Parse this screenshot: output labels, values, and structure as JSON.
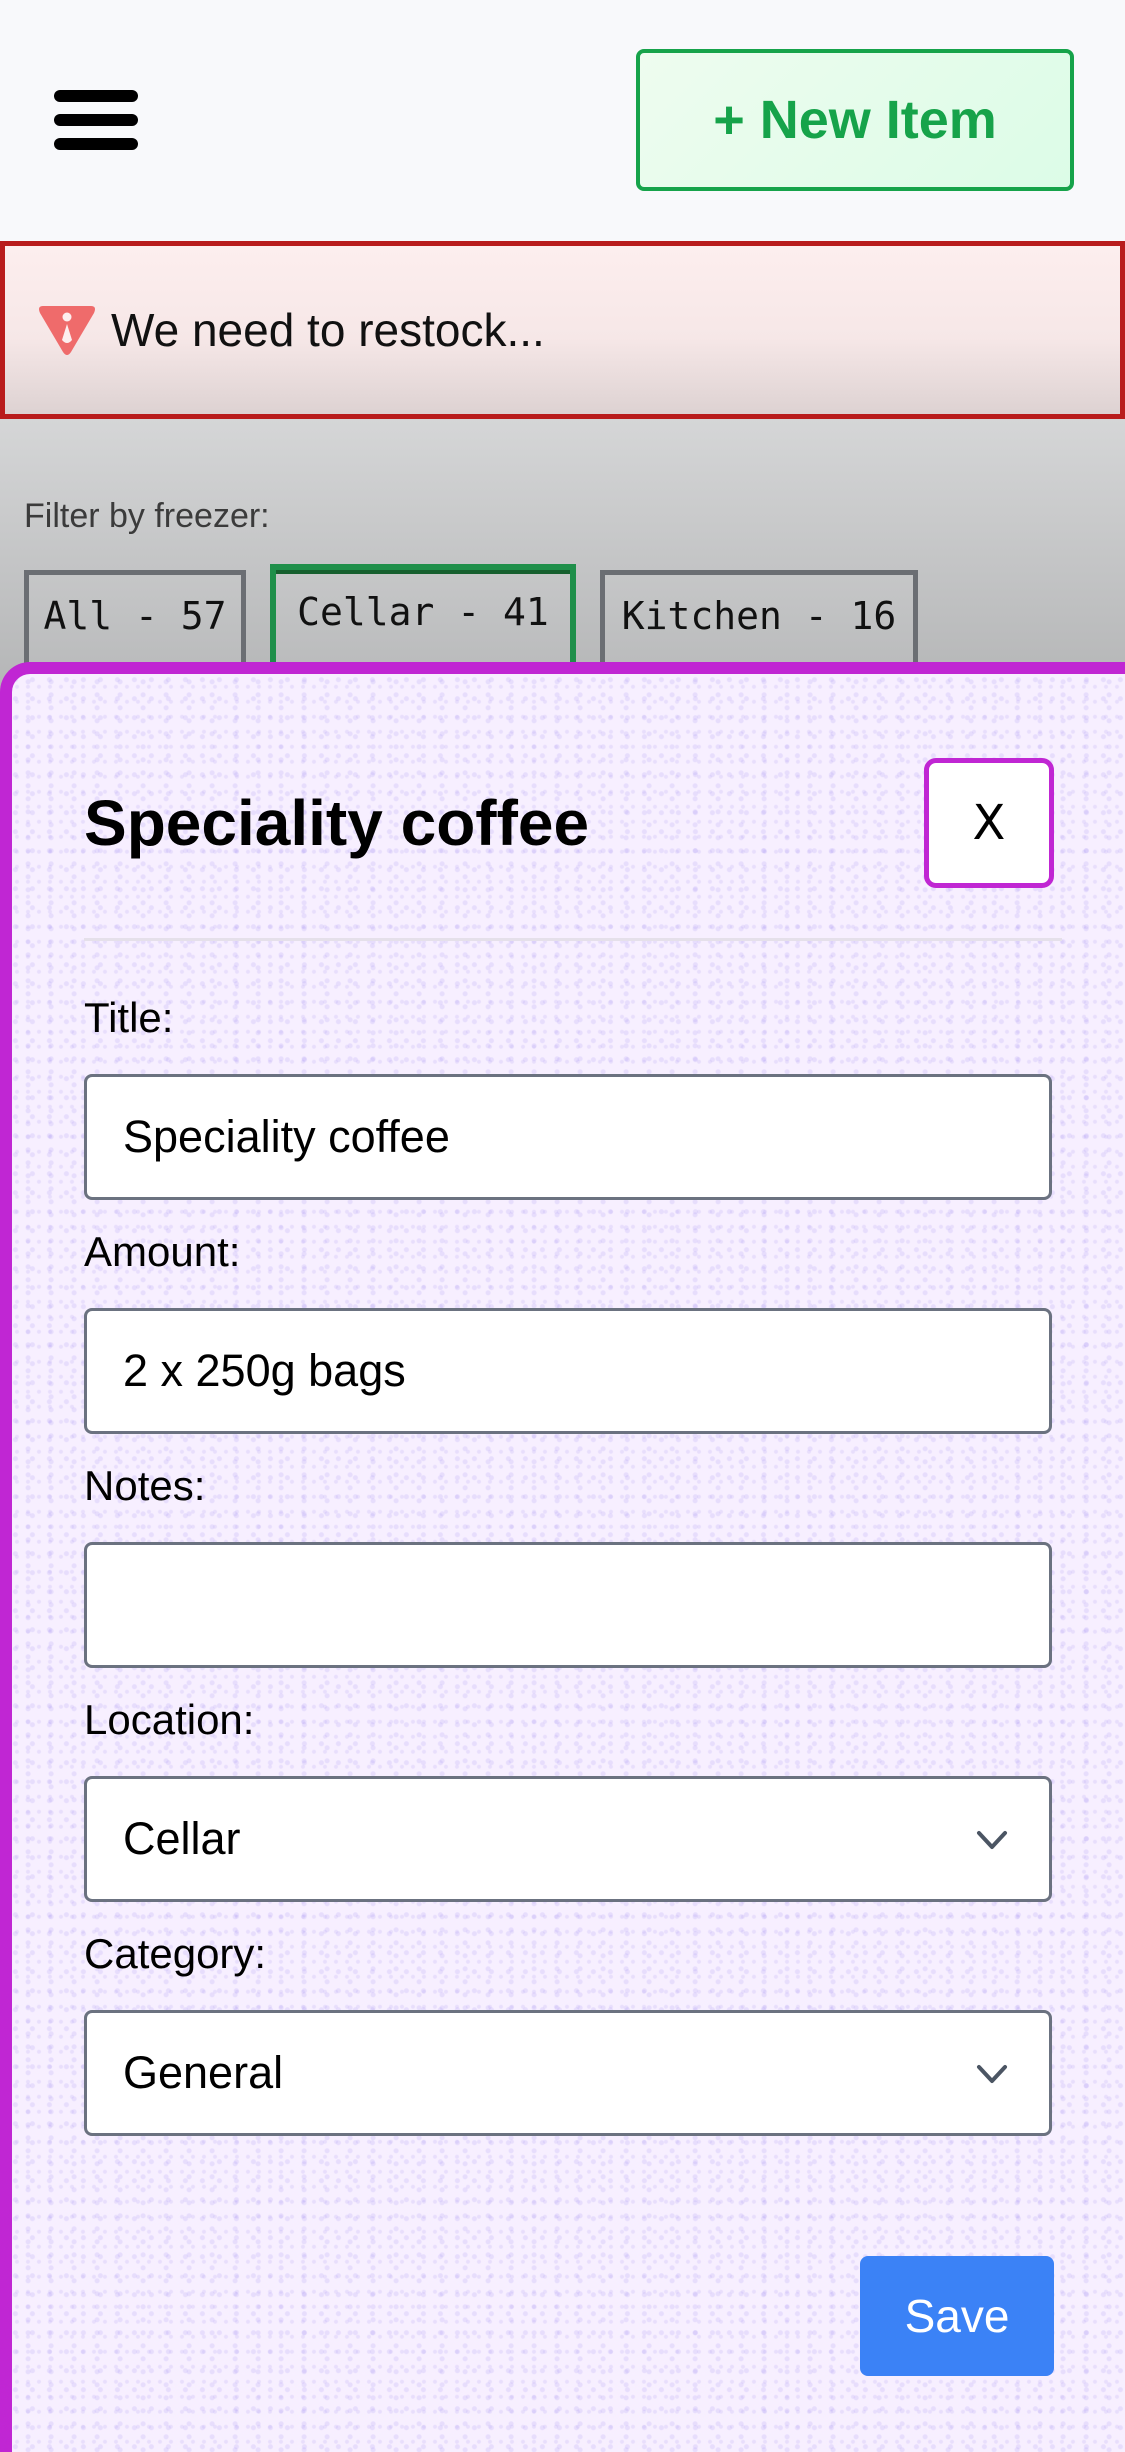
{
  "header": {
    "menu_icon": "hamburger-menu-icon",
    "new_item_label": "+ New Item"
  },
  "alert": {
    "icon": "warning-triangle-icon",
    "text": "We need to restock...",
    "border_color": "#b91c1c"
  },
  "filter": {
    "label": "Filter by freezer:",
    "tabs": [
      {
        "label": "All - 57",
        "selected": false
      },
      {
        "label": "Cellar - 41",
        "selected": true
      },
      {
        "label": "Kitchen - 16",
        "selected": false
      }
    ]
  },
  "modal": {
    "title": "Speciality coffee",
    "close_label": "X",
    "accent_color": "#c026d3",
    "fields": {
      "title": {
        "label": "Title:",
        "value": "Speciality coffee"
      },
      "amount": {
        "label": "Amount:",
        "value": "2 x 250g bags"
      },
      "notes": {
        "label": "Notes:",
        "value": ""
      },
      "location": {
        "label": "Location:",
        "value": "Cellar"
      },
      "category": {
        "label": "Category:",
        "value": "General"
      }
    },
    "save_label": "Save",
    "save_color": "#3b82f6"
  }
}
